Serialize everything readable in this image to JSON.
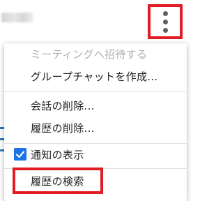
{
  "header": {
    "more_icon": "more-vertical-icon"
  },
  "menu": {
    "items": [
      {
        "label": "ミーティングへ招待する",
        "enabled": false
      },
      {
        "label": "グループチャットを作成...",
        "enabled": true
      },
      {
        "label": "会話の削除...",
        "enabled": true
      },
      {
        "label": "履歴の削除...",
        "enabled": true
      },
      {
        "label": "通知の表示",
        "enabled": true,
        "checked": true
      },
      {
        "label": "履歴の検索",
        "enabled": true
      }
    ]
  },
  "colors": {
    "highlight": "#e11c24",
    "checkbox": "#1a73e8",
    "disabled_text": "#aeaeae"
  }
}
